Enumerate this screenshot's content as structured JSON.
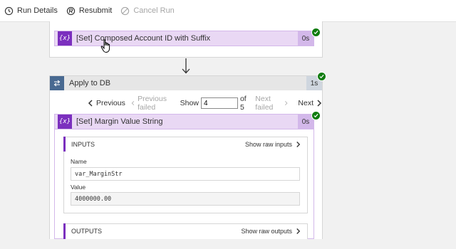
{
  "toolbar": {
    "run_details": "Run Details",
    "resubmit": "Resubmit",
    "cancel_run": "Cancel Run"
  },
  "first_action": {
    "title": "[Set] Composed Account ID with Suffix",
    "duration": "0s",
    "icon_text": "{x}"
  },
  "apply_to_each": {
    "title": "Apply to DB",
    "duration": "1s"
  },
  "pager": {
    "previous": "Previous",
    "previous_failed": "Previous failed",
    "show": "Show",
    "current": "4",
    "of": "of 5",
    "next_failed": "Next failed",
    "next": "Next"
  },
  "inner_action": {
    "title": "[Set] Margin Value String",
    "duration": "0s",
    "icon_text": "{x}"
  },
  "inputs": {
    "heading": "INPUTS",
    "show_raw": "Show raw inputs",
    "name_label": "Name",
    "name_value": "var_MarginStr",
    "value_label": "Value",
    "value_value": "4000000.00"
  },
  "outputs": {
    "heading": "OUTPUTS",
    "show_raw": "Show raw outputs"
  },
  "colors": {
    "variable_purple": "#7b2fbe",
    "header_lavender": "#e9d8f4",
    "success_green": "#107c10",
    "loop_blue": "#486991"
  }
}
